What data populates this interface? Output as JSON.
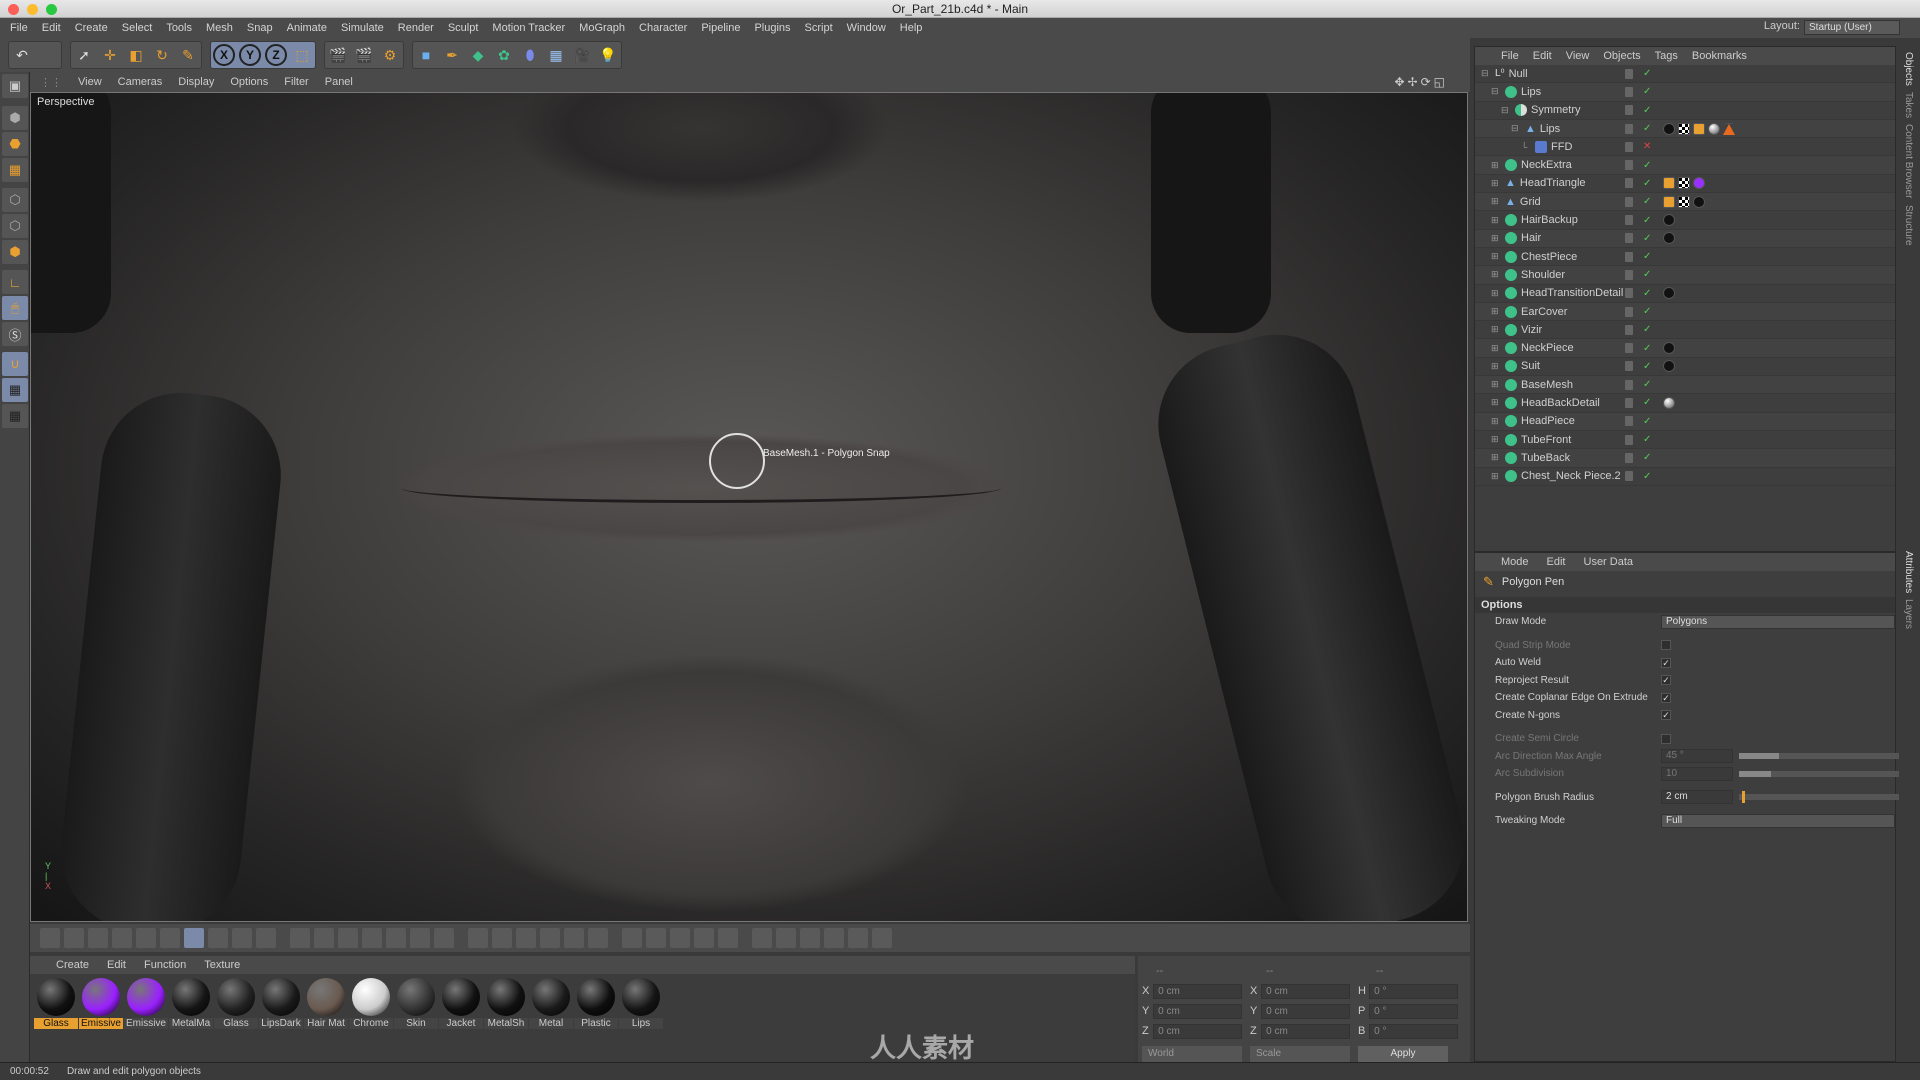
{
  "window": {
    "title": "Or_Part_21b.c4d * - Main"
  },
  "menubar": {
    "items": [
      "File",
      "Edit",
      "Create",
      "Select",
      "Tools",
      "Mesh",
      "Snap",
      "Animate",
      "Simulate",
      "Render",
      "Sculpt",
      "Motion Tracker",
      "MoGraph",
      "Character",
      "Pipeline",
      "Plugins",
      "Script",
      "Window",
      "Help"
    ],
    "layout_label": "Layout:",
    "layout_value": "Startup (User)"
  },
  "toolbar": {
    "axis": [
      "X",
      "Y",
      "Z"
    ]
  },
  "viewport": {
    "menu": [
      "View",
      "Cameras",
      "Display",
      "Options",
      "Filter",
      "Panel"
    ],
    "camera_label": "Perspective",
    "snap_tooltip": "BaseMesh.1 - Polygon Snap",
    "gizmo_y": "Y",
    "gizmo_x": "X"
  },
  "object_manager": {
    "menu": [
      "File",
      "Edit",
      "View",
      "Objects",
      "Tags",
      "Bookmarks"
    ],
    "objects": [
      {
        "name": "Null",
        "type": "null",
        "depth": 0,
        "tags": []
      },
      {
        "name": "Lips",
        "type": "subdiv",
        "depth": 1,
        "tags": []
      },
      {
        "name": "Symmetry",
        "type": "symmetry",
        "depth": 2,
        "tags": []
      },
      {
        "name": "Lips",
        "type": "poly",
        "depth": 3,
        "tags": [
          "material-black",
          "checker",
          "uv",
          "material-white",
          "phong-triangle"
        ]
      },
      {
        "name": "FFD",
        "type": "ffd",
        "depth": 4,
        "tags": []
      },
      {
        "name": "NeckExtra",
        "type": "subdiv",
        "depth": 1,
        "tags": []
      },
      {
        "name": "HeadTriangle",
        "type": "poly",
        "depth": 1,
        "tags": [
          "uv",
          "checker",
          "material-purple"
        ]
      },
      {
        "name": "Grid",
        "type": "poly",
        "depth": 1,
        "tags": [
          "uv",
          "checker",
          "material-black"
        ]
      },
      {
        "name": "HairBackup",
        "type": "subdiv",
        "depth": 1,
        "tags": [
          "material-black"
        ]
      },
      {
        "name": "Hair",
        "type": "subdiv",
        "depth": 1,
        "tags": [
          "material-black"
        ]
      },
      {
        "name": "ChestPiece",
        "type": "subdiv",
        "depth": 1,
        "tags": []
      },
      {
        "name": "Shoulder",
        "type": "subdiv",
        "depth": 1,
        "tags": []
      },
      {
        "name": "HeadTransitionDetail",
        "type": "subdiv",
        "depth": 1,
        "tags": [
          "material-black"
        ]
      },
      {
        "name": "EarCover",
        "type": "subdiv",
        "depth": 1,
        "tags": []
      },
      {
        "name": "Vizir",
        "type": "subdiv",
        "depth": 1,
        "tags": []
      },
      {
        "name": "NeckPiece",
        "type": "subdiv",
        "depth": 1,
        "tags": [
          "material-black"
        ]
      },
      {
        "name": "Suit",
        "type": "subdiv",
        "depth": 1,
        "tags": [
          "material-black"
        ]
      },
      {
        "name": "BaseMesh",
        "type": "subdiv",
        "depth": 1,
        "tags": []
      },
      {
        "name": "HeadBackDetail",
        "type": "subdiv",
        "depth": 1,
        "tags": [
          "material-white"
        ]
      },
      {
        "name": "HeadPiece",
        "type": "subdiv",
        "depth": 1,
        "tags": []
      },
      {
        "name": "TubeFront",
        "type": "subdiv",
        "depth": 1,
        "tags": []
      },
      {
        "name": "TubeBack",
        "type": "subdiv",
        "depth": 1,
        "tags": []
      },
      {
        "name": "Chest_Neck Piece.2",
        "type": "subdiv",
        "depth": 1,
        "tags": []
      }
    ]
  },
  "right_tabs": [
    "Objects",
    "Takes",
    "Content Browser",
    "Structure"
  ],
  "right_tabs_lower": [
    "Attributes",
    "Layers"
  ],
  "attributes": {
    "menu": [
      "Mode",
      "Edit",
      "User Data"
    ],
    "tool_name": "Polygon Pen",
    "section": "Options",
    "rows": [
      {
        "label": "Draw Mode",
        "kind": "dropdown",
        "value": "Polygons",
        "enabled": true
      },
      {
        "label": "Quad Strip Mode",
        "kind": "check",
        "value": false,
        "enabled": false
      },
      {
        "label": "Auto Weld",
        "kind": "check",
        "value": true,
        "enabled": true
      },
      {
        "label": "Reproject Result",
        "kind": "check",
        "value": true,
        "enabled": true
      },
      {
        "label": "Create Coplanar Edge On Extrude",
        "kind": "check",
        "value": true,
        "enabled": true
      },
      {
        "label": "Create N-gons",
        "kind": "check",
        "value": true,
        "enabled": true
      },
      {
        "label": "Create Semi Circle",
        "kind": "check",
        "value": false,
        "enabled": false
      },
      {
        "label": "Arc Direction Max Angle",
        "kind": "slider",
        "value": "45 °",
        "fraction": 0.25,
        "enabled": false
      },
      {
        "label": "Arc Subdivision",
        "kind": "slider",
        "value": "10",
        "fraction": 0.2,
        "enabled": false
      },
      {
        "label": "Polygon Brush Radius",
        "kind": "slider",
        "value": "2 cm",
        "fraction": 0.02,
        "enabled": true
      },
      {
        "label": "Tweaking Mode",
        "kind": "dropdown",
        "value": "Full",
        "enabled": true
      }
    ]
  },
  "materials": {
    "menu": [
      "Create",
      "Edit",
      "Function",
      "Texture"
    ],
    "items": [
      {
        "name": "Glass",
        "color": "#111111",
        "selected": true
      },
      {
        "name": "Emissive",
        "color": "#9a20ff",
        "selected": true
      },
      {
        "name": "Emissive",
        "color": "#9a20ff",
        "selected": false
      },
      {
        "name": "MetalMa",
        "color": "#151515",
        "selected": false
      },
      {
        "name": "Glass",
        "color": "#222222",
        "selected": false
      },
      {
        "name": "LipsDark",
        "color": "#1a1a1a",
        "selected": false
      },
      {
        "name": "Hair Mat",
        "color": "#6a5a50",
        "selected": false
      },
      {
        "name": "Chrome",
        "color": "#cccccc",
        "selected": false
      },
      {
        "name": "Skin",
        "color": "#333333",
        "selected": false
      },
      {
        "name": "Jacket",
        "color": "#111111",
        "selected": false
      },
      {
        "name": "MetalSh",
        "color": "#111111",
        "selected": false
      },
      {
        "name": "Metal",
        "color": "#1a1a1a",
        "selected": false
      },
      {
        "name": "Plastic",
        "color": "#0e0e0e",
        "selected": false
      },
      {
        "name": "Lips",
        "color": "#151515",
        "selected": false
      }
    ]
  },
  "coordinates": {
    "header": [
      "--",
      "--",
      "--"
    ],
    "rows": [
      {
        "a": "X",
        "av": "0 cm",
        "b": "X",
        "bv": "0 cm",
        "c": "H",
        "cv": "0 °"
      },
      {
        "a": "Y",
        "av": "0 cm",
        "b": "Y",
        "bv": "0 cm",
        "c": "P",
        "cv": "0 °"
      },
      {
        "a": "Z",
        "av": "0 cm",
        "b": "Z",
        "bv": "0 cm",
        "c": "B",
        "cv": "0 °"
      }
    ],
    "space": "World",
    "mode": "Scale",
    "apply": "Apply"
  },
  "status": {
    "time": "00:00:52",
    "message": "Draw and edit polygon objects"
  },
  "watermark": "人人素材"
}
